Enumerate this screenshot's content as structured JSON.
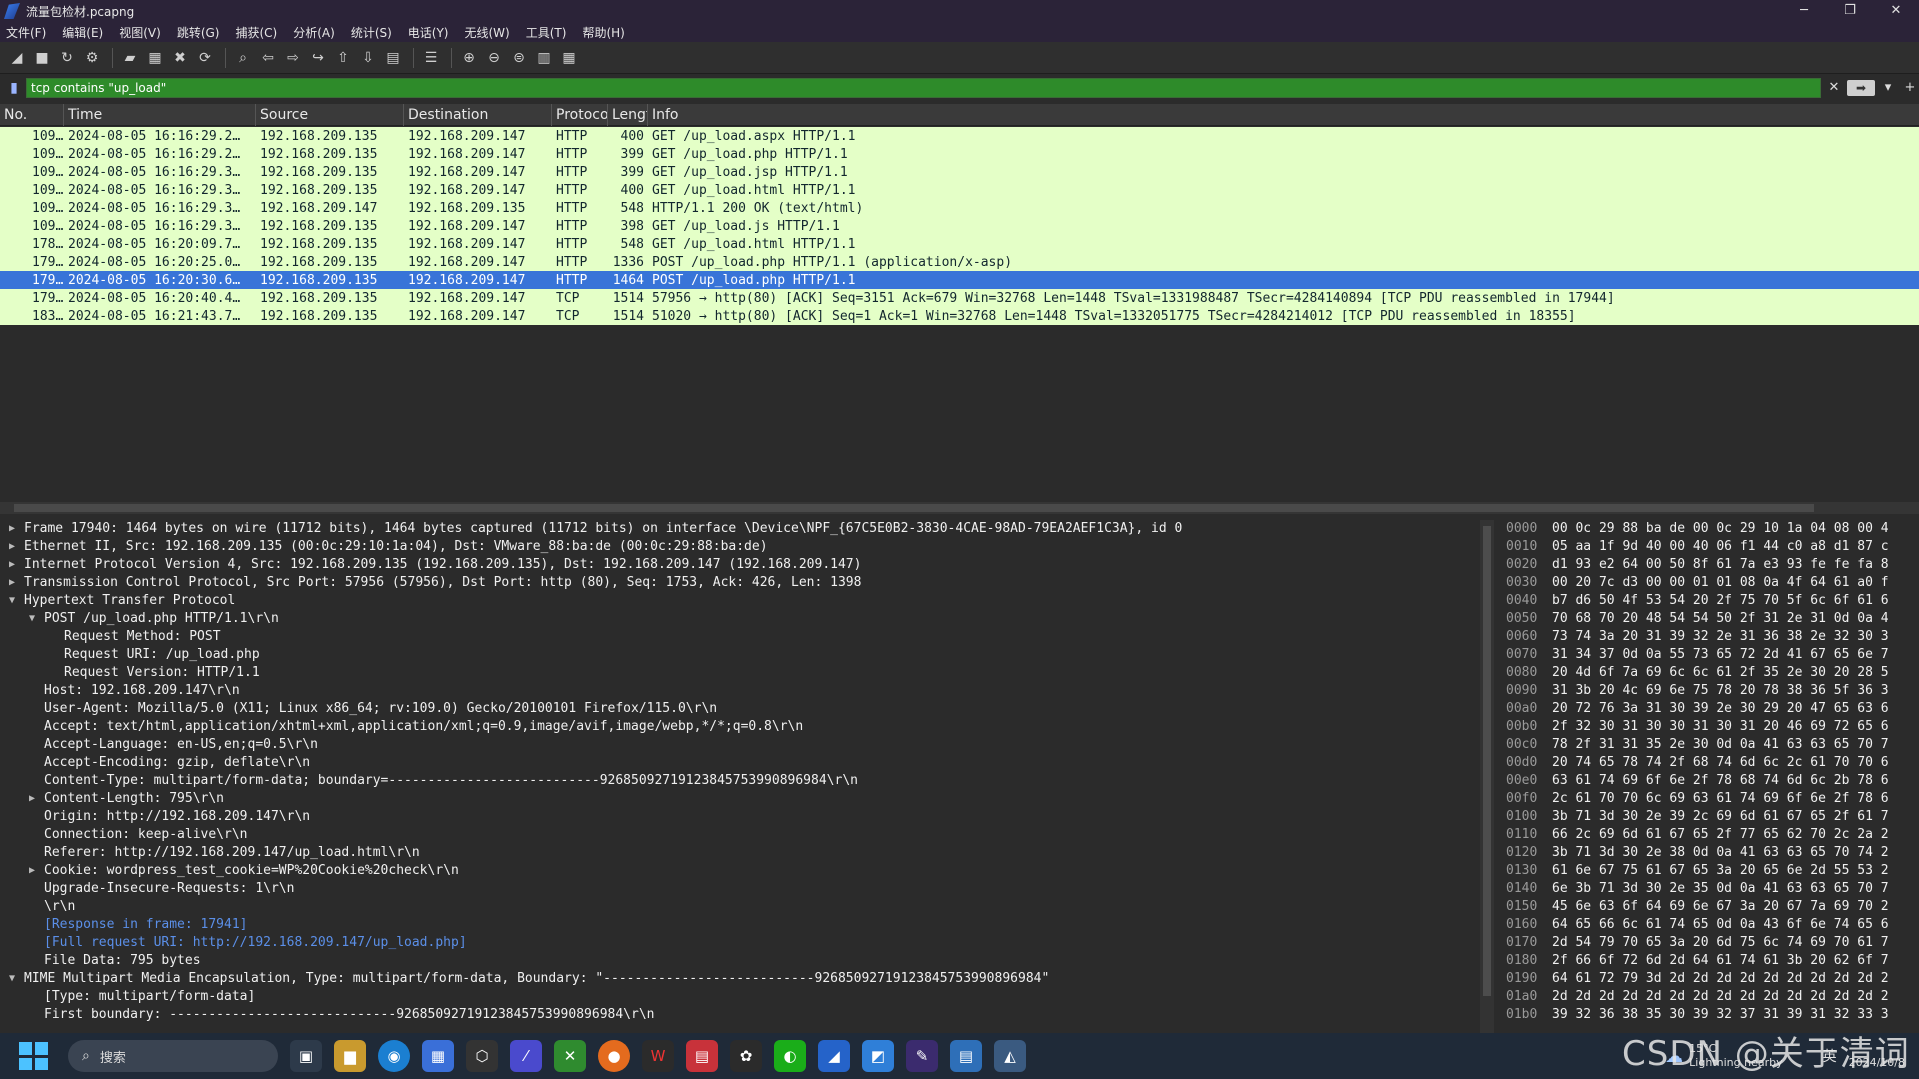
{
  "window": {
    "title": "流量包检材.pcapng",
    "minimize": "─",
    "maximize": "❐",
    "close": "✕"
  },
  "menu": [
    "文件(F)",
    "编辑(E)",
    "视图(V)",
    "跳转(G)",
    "捕获(C)",
    "分析(A)",
    "统计(S)",
    "电话(Y)",
    "无线(W)",
    "工具(T)",
    "帮助(H)"
  ],
  "toolbar_icons": [
    "shark-fin-icon",
    "stop-icon",
    "restart-icon",
    "options-icon",
    "open-icon",
    "save-icon",
    "close-file-icon",
    "reload-icon",
    "find-icon",
    "back-icon",
    "forward-icon",
    "goto-icon",
    "first-icon",
    "last-icon",
    "autoscroll-icon",
    "colorize-icon",
    "zoom-in-icon",
    "zoom-out-icon",
    "zoom-reset-icon",
    "resize-columns-icon",
    "layout-icon"
  ],
  "filter": {
    "value": "tcp contains \"up_load\"",
    "clear": "✕",
    "apply": "➡",
    "dropdown": "▾",
    "add": "+"
  },
  "columns": {
    "no": "No.",
    "time": "Time",
    "source": "Source",
    "destination": "Destination",
    "protocol": "Protocol",
    "length": "Length",
    "info": "Info"
  },
  "packets": [
    {
      "no": "109…",
      "time": "2024-08-05 16:16:29.2…",
      "src": "192.168.209.135",
      "dst": "192.168.209.147",
      "proto": "HTTP",
      "len": "400",
      "info": "GET /up_load.aspx HTTP/1.1",
      "sel": false
    },
    {
      "no": "109…",
      "time": "2024-08-05 16:16:29.2…",
      "src": "192.168.209.135",
      "dst": "192.168.209.147",
      "proto": "HTTP",
      "len": "399",
      "info": "GET /up_load.php HTTP/1.1",
      "sel": false
    },
    {
      "no": "109…",
      "time": "2024-08-05 16:16:29.3…",
      "src": "192.168.209.135",
      "dst": "192.168.209.147",
      "proto": "HTTP",
      "len": "399",
      "info": "GET /up_load.jsp HTTP/1.1",
      "sel": false
    },
    {
      "no": "109…",
      "time": "2024-08-05 16:16:29.3…",
      "src": "192.168.209.135",
      "dst": "192.168.209.147",
      "proto": "HTTP",
      "len": "400",
      "info": "GET /up_load.html HTTP/1.1",
      "sel": false
    },
    {
      "no": "109…",
      "time": "2024-08-05 16:16:29.3…",
      "src": "192.168.209.147",
      "dst": "192.168.209.135",
      "proto": "HTTP",
      "len": "548",
      "info": "HTTP/1.1 200 OK  (text/html)",
      "sel": false
    },
    {
      "no": "109…",
      "time": "2024-08-05 16:16:29.3…",
      "src": "192.168.209.135",
      "dst": "192.168.209.147",
      "proto": "HTTP",
      "len": "398",
      "info": "GET /up_load.js HTTP/1.1",
      "sel": false
    },
    {
      "no": "178…",
      "time": "2024-08-05 16:20:09.7…",
      "src": "192.168.209.135",
      "dst": "192.168.209.147",
      "proto": "HTTP",
      "len": "548",
      "info": "GET /up_load.html HTTP/1.1",
      "sel": false
    },
    {
      "no": "179…",
      "time": "2024-08-05 16:20:25.0…",
      "src": "192.168.209.135",
      "dst": "192.168.209.147",
      "proto": "HTTP",
      "len": "1336",
      "info": "POST /up_load.php HTTP/1.1  (application/x-asp)",
      "sel": false
    },
    {
      "no": "179…",
      "time": "2024-08-05 16:20:30.6…",
      "src": "192.168.209.135",
      "dst": "192.168.209.147",
      "proto": "HTTP",
      "len": "1464",
      "info": "POST /up_load.php HTTP/1.1",
      "sel": true
    },
    {
      "no": "179…",
      "time": "2024-08-05 16:20:40.4…",
      "src": "192.168.209.135",
      "dst": "192.168.209.147",
      "proto": "TCP",
      "len": "1514",
      "info": "57956 → http(80) [ACK] Seq=3151 Ack=679 Win=32768 Len=1448 TSval=1331988487 TSecr=4284140894 [TCP PDU reassembled in 17944]",
      "sel": false
    },
    {
      "no": "183…",
      "time": "2024-08-05 16:21:43.7…",
      "src": "192.168.209.135",
      "dst": "192.168.209.147",
      "proto": "TCP",
      "len": "1514",
      "info": "51020 → http(80) [ACK] Seq=1 Ack=1 Win=32768 Len=1448 TSval=1332051775 TSecr=4284214012 [TCP PDU reassembled in 18355]",
      "sel": false
    }
  ],
  "details": [
    {
      "indent": 0,
      "arrow": "right",
      "text": "Frame 17940: 1464 bytes on wire (11712 bits), 1464 bytes captured (11712 bits) on interface \\Device\\NPF_{67C5E0B2-3830-4CAE-98AD-79EA2AEF1C3A}, id 0"
    },
    {
      "indent": 0,
      "arrow": "right",
      "text": "Ethernet II, Src: 192.168.209.135 (00:0c:29:10:1a:04), Dst: VMware_88:ba:de (00:0c:29:88:ba:de)"
    },
    {
      "indent": 0,
      "arrow": "right",
      "text": "Internet Protocol Version 4, Src: 192.168.209.135 (192.168.209.135), Dst: 192.168.209.147 (192.168.209.147)"
    },
    {
      "indent": 0,
      "arrow": "right",
      "text": "Transmission Control Protocol, Src Port: 57956 (57956), Dst Port: http (80), Seq: 1753, Ack: 426, Len: 1398"
    },
    {
      "indent": 0,
      "arrow": "down",
      "text": "Hypertext Transfer Protocol"
    },
    {
      "indent": 1,
      "arrow": "down",
      "text": "POST /up_load.php HTTP/1.1\\r\\n"
    },
    {
      "indent": 2,
      "arrow": "",
      "text": "Request Method: POST"
    },
    {
      "indent": 2,
      "arrow": "",
      "text": "Request URI: /up_load.php"
    },
    {
      "indent": 2,
      "arrow": "",
      "text": "Request Version: HTTP/1.1"
    },
    {
      "indent": 1,
      "arrow": "",
      "text": "Host: 192.168.209.147\\r\\n"
    },
    {
      "indent": 1,
      "arrow": "",
      "text": "User-Agent: Mozilla/5.0 (X11; Linux x86_64; rv:109.0) Gecko/20100101 Firefox/115.0\\r\\n"
    },
    {
      "indent": 1,
      "arrow": "",
      "text": "Accept: text/html,application/xhtml+xml,application/xml;q=0.9,image/avif,image/webp,*/*;q=0.8\\r\\n"
    },
    {
      "indent": 1,
      "arrow": "",
      "text": "Accept-Language: en-US,en;q=0.5\\r\\n"
    },
    {
      "indent": 1,
      "arrow": "",
      "text": "Accept-Encoding: gzip, deflate\\r\\n"
    },
    {
      "indent": 1,
      "arrow": "",
      "text": "Content-Type: multipart/form-data; boundary=---------------------------92685092719123845753990896984\\r\\n"
    },
    {
      "indent": 1,
      "arrow": "right",
      "text": "Content-Length: 795\\r\\n"
    },
    {
      "indent": 1,
      "arrow": "",
      "text": "Origin: http://192.168.209.147\\r\\n"
    },
    {
      "indent": 1,
      "arrow": "",
      "text": "Connection: keep-alive\\r\\n"
    },
    {
      "indent": 1,
      "arrow": "",
      "text": "Referer: http://192.168.209.147/up_load.html\\r\\n"
    },
    {
      "indent": 1,
      "arrow": "right",
      "text": "Cookie: wordpress_test_cookie=WP%20Cookie%20check\\r\\n"
    },
    {
      "indent": 1,
      "arrow": "",
      "text": "Upgrade-Insecure-Requests: 1\\r\\n"
    },
    {
      "indent": 1,
      "arrow": "",
      "text": "\\r\\n"
    },
    {
      "indent": 1,
      "arrow": "",
      "text": "[Response in frame: 17941]",
      "link": true
    },
    {
      "indent": 1,
      "arrow": "",
      "text": "[Full request URI: http://192.168.209.147/up_load.php]",
      "link": true
    },
    {
      "indent": 1,
      "arrow": "",
      "text": "File Data: 795 bytes"
    },
    {
      "indent": 0,
      "arrow": "down",
      "text": "MIME Multipart Media Encapsulation, Type: multipart/form-data, Boundary: \"---------------------------92685092719123845753990896984\""
    },
    {
      "indent": 1,
      "arrow": "",
      "text": "[Type: multipart/form-data]"
    },
    {
      "indent": 1,
      "arrow": "",
      "text": "First boundary: -----------------------------92685092719123845753990896984\\r\\n"
    }
  ],
  "bytes": [
    {
      "off": "0000",
      "hex": "00 0c 29 88 ba de 00 0c  29 10 1a 04 08 00 4"
    },
    {
      "off": "0010",
      "hex": "05 aa 1f 9d 40 00 40 06  f1 44 c0 a8 d1 87 c"
    },
    {
      "off": "0020",
      "hex": "d1 93 e2 64 00 50 8f 61  7a e3 93 fe fe fa 8"
    },
    {
      "off": "0030",
      "hex": "00 20 7c d3 00 00 01 01  08 0a 4f 64 61 a0 f"
    },
    {
      "off": "0040",
      "hex": "b7 d6 50 4f 53 54 20 2f  75 70 5f 6c 6f 61 6"
    },
    {
      "off": "0050",
      "hex": "70 68 70 20 48 54 54 50  2f 31 2e 31 0d 0a 4"
    },
    {
      "off": "0060",
      "hex": "73 74 3a 20 31 39 32 2e  31 36 38 2e 32 30 3"
    },
    {
      "off": "0070",
      "hex": "31 34 37 0d 0a 55 73 65  72 2d 41 67 65 6e 7"
    },
    {
      "off": "0080",
      "hex": "20 4d 6f 7a 69 6c 6c 61  2f 35 2e 30 20 28 5"
    },
    {
      "off": "0090",
      "hex": "31 3b 20 4c 69 6e 75 78  20 78 38 36 5f 36 3"
    },
    {
      "off": "00a0",
      "hex": "20 72 76 3a 31 30 39 2e  30 29 20 47 65 63 6"
    },
    {
      "off": "00b0",
      "hex": "2f 32 30 31 30 30 31 30  31 20 46 69 72 65 6"
    },
    {
      "off": "00c0",
      "hex": "78 2f 31 31 35 2e 30 0d  0a 41 63 63 65 70 7"
    },
    {
      "off": "00d0",
      "hex": "20 74 65 78 74 2f 68 74  6d 6c 2c 61 70 70 6"
    },
    {
      "off": "00e0",
      "hex": "63 61 74 69 6f 6e 2f 78  68 74 6d 6c 2b 78 6"
    },
    {
      "off": "00f0",
      "hex": "2c 61 70 70 6c 69 63 61  74 69 6f 6e 2f 78 6"
    },
    {
      "off": "0100",
      "hex": "3b 71 3d 30 2e 39 2c 69  6d 61 67 65 2f 61 7"
    },
    {
      "off": "0110",
      "hex": "66 2c 69 6d 61 67 65 2f  77 65 62 70 2c 2a 2"
    },
    {
      "off": "0120",
      "hex": "3b 71 3d 30 2e 38 0d 0a  41 63 63 65 70 74 2"
    },
    {
      "off": "0130",
      "hex": "61 6e 67 75 61 67 65 3a  20 65 6e 2d 55 53 2"
    },
    {
      "off": "0140",
      "hex": "6e 3b 71 3d 30 2e 35 0d  0a 41 63 63 65 70 7"
    },
    {
      "off": "0150",
      "hex": "45 6e 63 6f 64 69 6e 67  3a 20 67 7a 69 70 2"
    },
    {
      "off": "0160",
      "hex": "64 65 66 6c 61 74 65 0d  0a 43 6f 6e 74 65 6"
    },
    {
      "off": "0170",
      "hex": "2d 54 79 70 65 3a 20 6d  75 6c 74 69 70 61 7"
    },
    {
      "off": "0180",
      "hex": "2f 66 6f 72 6d 2d 64 61  74 61 3b 20 62 6f 7"
    },
    {
      "off": "0190",
      "hex": "64 61 72 79 3d 2d 2d 2d  2d 2d 2d 2d 2d 2d 2"
    },
    {
      "off": "01a0",
      "hex": "2d 2d 2d 2d 2d 2d 2d 2d  2d 2d 2d 2d 2d 2d 2"
    },
    {
      "off": "01b0",
      "hex": "39 32 36 38 35 30 39 32  37 31 39 31 32 33 3"
    }
  ],
  "taskbar": {
    "search_placeholder": "搜索",
    "weather_temp": "15°C",
    "weather_desc": "Lightning nearby",
    "ime": "英",
    "date": "2024/10/8"
  },
  "watermark": "CSDN @关于清词",
  "colors": {
    "row_bg": "#e4ffc7",
    "selected_bg": "#3874d8",
    "filter_bg": "#2e8b2a",
    "link": "#5b8fe8"
  }
}
